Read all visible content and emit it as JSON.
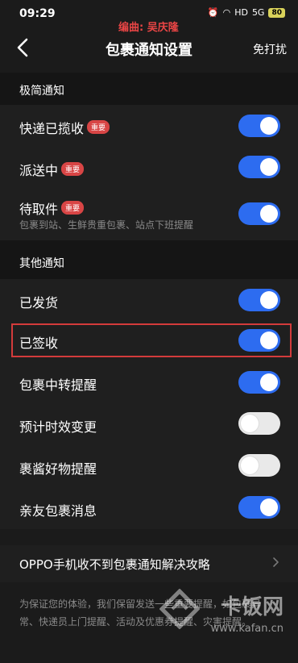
{
  "status": {
    "time": "09:29",
    "editor_watermark": "编曲: 吴庆隆",
    "network_a": "HD",
    "network_b": "5G",
    "battery": "80"
  },
  "nav": {
    "title": "包裹通知设置",
    "right_action": "免打扰"
  },
  "sections": {
    "simple": "极简通知",
    "other": "其他通知"
  },
  "badge_label": "重要",
  "rows": {
    "courier_picked": {
      "label": "快递已揽收",
      "on": true
    },
    "delivering": {
      "label": "派送中",
      "on": true
    },
    "pending_pickup": {
      "label": "待取件",
      "sub": "包裹到站、生鲜贵重包裹、站点下班提醒",
      "on": true
    },
    "shipped": {
      "label": "已发货",
      "on": true
    },
    "signed": {
      "label": "已签收",
      "on": true
    },
    "transfer": {
      "label": "包裹中转提醒",
      "on": true
    },
    "eta_change": {
      "label": "预计时效变更",
      "on": false
    },
    "goodies": {
      "label": "裹酱好物提醒",
      "on": false
    },
    "family": {
      "label": "亲友包裹消息",
      "on": true
    }
  },
  "guide": {
    "label": "OPPO手机收不到包裹通知解决攻略"
  },
  "footer": {
    "text": "为保证您的体验，我们保留发送一些重要提醒，如包裹异常、快递员上门提醒、活动及优惠券提醒、灾害提醒。"
  },
  "site_watermark": {
    "brand": "卡饭网",
    "url": "www.kafan.cn"
  },
  "colors": {
    "toggle_on": "#2d6cf0",
    "badge": "#d84545",
    "highlight": "#d33b3b"
  }
}
